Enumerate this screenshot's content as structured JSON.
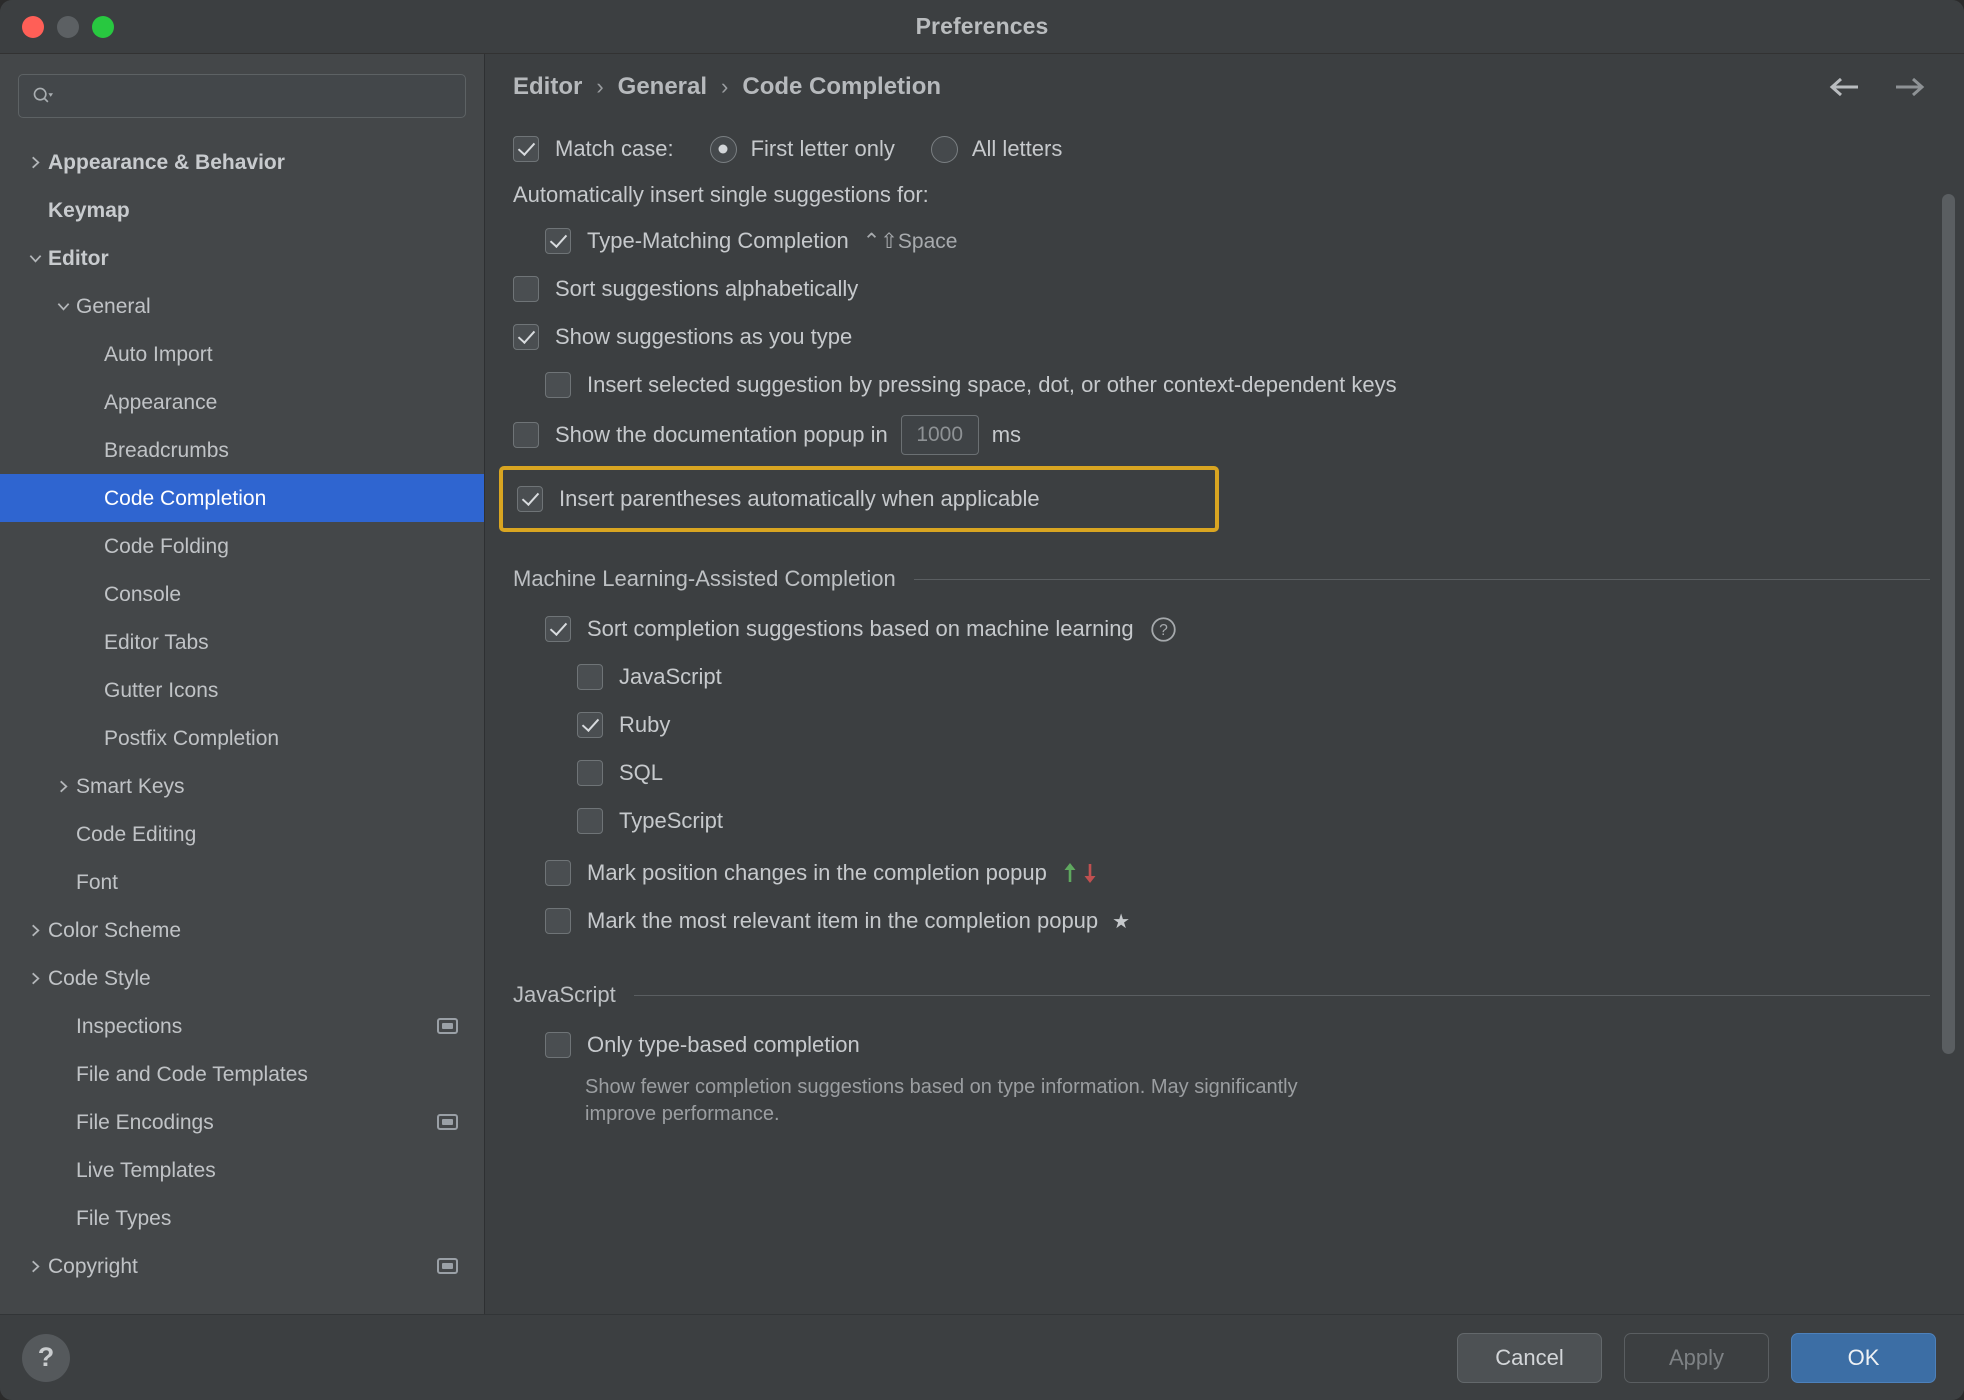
{
  "window": {
    "title": "Preferences",
    "traffic_lights": [
      "close-red",
      "minimize-yellow",
      "zoom-green"
    ]
  },
  "sidebar": {
    "search": {
      "value": "",
      "placeholder": ""
    },
    "items": [
      {
        "label": "Appearance & Behavior",
        "indent": 0,
        "twisty": "right",
        "bold": true,
        "selected": false,
        "badge": false
      },
      {
        "label": "Keymap",
        "indent": 0,
        "twisty": "none",
        "bold": true,
        "selected": false,
        "badge": false
      },
      {
        "label": "Editor",
        "indent": 0,
        "twisty": "down",
        "bold": true,
        "selected": false,
        "badge": false
      },
      {
        "label": "General",
        "indent": 1,
        "twisty": "down",
        "bold": false,
        "selected": false,
        "badge": false
      },
      {
        "label": "Auto Import",
        "indent": 2,
        "twisty": "none",
        "bold": false,
        "selected": false,
        "badge": false
      },
      {
        "label": "Appearance",
        "indent": 2,
        "twisty": "none",
        "bold": false,
        "selected": false,
        "badge": false
      },
      {
        "label": "Breadcrumbs",
        "indent": 2,
        "twisty": "none",
        "bold": false,
        "selected": false,
        "badge": false
      },
      {
        "label": "Code Completion",
        "indent": 2,
        "twisty": "none",
        "bold": false,
        "selected": true,
        "badge": false
      },
      {
        "label": "Code Folding",
        "indent": 2,
        "twisty": "none",
        "bold": false,
        "selected": false,
        "badge": false
      },
      {
        "label": "Console",
        "indent": 2,
        "twisty": "none",
        "bold": false,
        "selected": false,
        "badge": false
      },
      {
        "label": "Editor Tabs",
        "indent": 2,
        "twisty": "none",
        "bold": false,
        "selected": false,
        "badge": false
      },
      {
        "label": "Gutter Icons",
        "indent": 2,
        "twisty": "none",
        "bold": false,
        "selected": false,
        "badge": false
      },
      {
        "label": "Postfix Completion",
        "indent": 2,
        "twisty": "none",
        "bold": false,
        "selected": false,
        "badge": false
      },
      {
        "label": "Smart Keys",
        "indent": 1,
        "twisty": "right",
        "bold": false,
        "selected": false,
        "badge": false
      },
      {
        "label": "Code Editing",
        "indent": 1,
        "twisty": "none",
        "bold": false,
        "selected": false,
        "badge": false
      },
      {
        "label": "Font",
        "indent": 1,
        "twisty": "none",
        "bold": false,
        "selected": false,
        "badge": false
      },
      {
        "label": "Color Scheme",
        "indent": 0,
        "twisty": "right",
        "bold": false,
        "selected": false,
        "badge": false
      },
      {
        "label": "Code Style",
        "indent": 0,
        "twisty": "right",
        "bold": false,
        "selected": false,
        "badge": false
      },
      {
        "label": "Inspections",
        "indent": 1,
        "twisty": "none",
        "bold": false,
        "selected": false,
        "badge": true
      },
      {
        "label": "File and Code Templates",
        "indent": 1,
        "twisty": "none",
        "bold": false,
        "selected": false,
        "badge": false
      },
      {
        "label": "File Encodings",
        "indent": 1,
        "twisty": "none",
        "bold": false,
        "selected": false,
        "badge": true
      },
      {
        "label": "Live Templates",
        "indent": 1,
        "twisty": "none",
        "bold": false,
        "selected": false,
        "badge": false
      },
      {
        "label": "File Types",
        "indent": 1,
        "twisty": "none",
        "bold": false,
        "selected": false,
        "badge": false
      },
      {
        "label": "Copyright",
        "indent": 0,
        "twisty": "right",
        "bold": false,
        "selected": false,
        "badge": true
      }
    ]
  },
  "breadcrumb": {
    "items": [
      "Editor",
      "General",
      "Code Completion"
    ],
    "separator": "›"
  },
  "nav": {
    "back": "back-arrow",
    "forward": "forward-arrow"
  },
  "main": {
    "match_case": {
      "checked": true,
      "label": "Match case:",
      "options": [
        {
          "label": "First letter only",
          "selected": true
        },
        {
          "label": "All letters",
          "selected": false
        }
      ]
    },
    "auto_insert_label": "Automatically insert single suggestions for:",
    "type_matching": {
      "checked": true,
      "label": "Type-Matching Completion",
      "shortcut": "⌃⇧Space"
    },
    "sort_alphabetically": {
      "checked": false,
      "label": "Sort suggestions alphabetically"
    },
    "show_as_you_type": {
      "checked": true,
      "label": "Show suggestions as you type"
    },
    "insert_selected": {
      "checked": false,
      "label": "Insert selected suggestion by pressing space, dot, or other context-dependent keys"
    },
    "doc_popup": {
      "checked": false,
      "label_before": "Show the documentation popup in",
      "delay_value": "1000",
      "label_after": "ms"
    },
    "insert_parentheses": {
      "checked": true,
      "label": "Insert parentheses automatically when applicable",
      "highlighted": true,
      "highlight_color": "#d9a521"
    },
    "ml_section": {
      "title": "Machine Learning-Assisted Completion",
      "sort_ml": {
        "checked": true,
        "label": "Sort completion suggestions based on machine learning",
        "help_icon": "help-circle-icon"
      },
      "languages": [
        {
          "label": "JavaScript",
          "checked": false
        },
        {
          "label": "Ruby",
          "checked": true
        },
        {
          "label": "SQL",
          "checked": false
        },
        {
          "label": "TypeScript",
          "checked": false
        }
      ],
      "mark_position": {
        "checked": false,
        "label": "Mark position changes in the completion popup",
        "up_arrow_color": "#5fa85f",
        "down_arrow_color": "#c05050"
      },
      "mark_relevant": {
        "checked": false,
        "label": "Mark the most relevant item in the completion popup",
        "star": "★"
      }
    },
    "js_section": {
      "title": "JavaScript",
      "only_type_based": {
        "checked": false,
        "label": "Only type-based completion"
      },
      "description": "Show fewer completion suggestions based on type information. May significantly improve performance."
    }
  },
  "footer": {
    "help_label": "?",
    "cancel_label": "Cancel",
    "apply_label": "Apply",
    "apply_enabled": false,
    "ok_label": "OK"
  }
}
